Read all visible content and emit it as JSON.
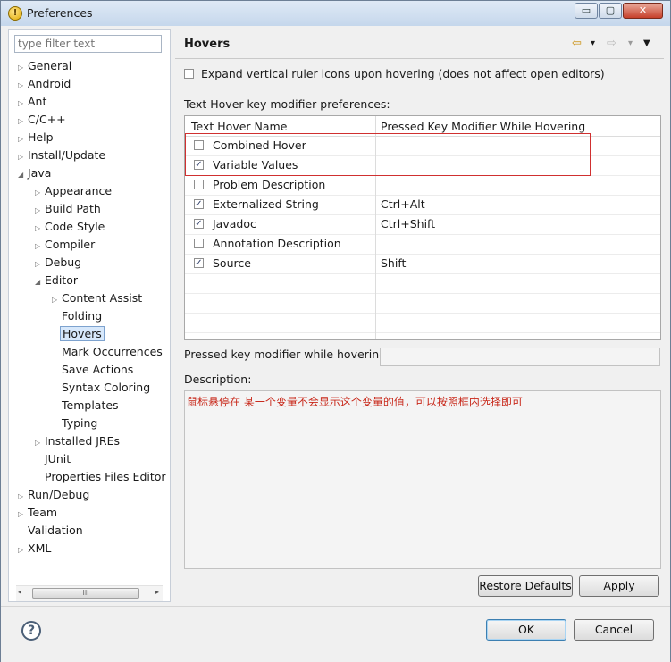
{
  "window": {
    "title": "Preferences",
    "app_icon": "eclipse-icon",
    "controls": {
      "minimize": "▭",
      "maximize": "▢",
      "close": "✕"
    }
  },
  "sidebar": {
    "filter_placeholder": "type filter text",
    "items": [
      {
        "label": "General",
        "toggle": "▷"
      },
      {
        "label": "Android",
        "toggle": "▷"
      },
      {
        "label": "Ant",
        "toggle": "▷"
      },
      {
        "label": "C/C++",
        "toggle": "▷"
      },
      {
        "label": "Help",
        "toggle": "▷"
      },
      {
        "label": "Install/Update",
        "toggle": "▷"
      },
      {
        "label": "Java",
        "toggle": "◢"
      },
      {
        "label": "Appearance",
        "toggle": "▷"
      },
      {
        "label": "Build Path",
        "toggle": "▷"
      },
      {
        "label": "Code Style",
        "toggle": "▷"
      },
      {
        "label": "Compiler",
        "toggle": "▷"
      },
      {
        "label": "Debug",
        "toggle": "▷"
      },
      {
        "label": "Editor",
        "toggle": "◢"
      },
      {
        "label": "Content Assist",
        "toggle": "▷"
      },
      {
        "label": "Folding",
        "toggle": ""
      },
      {
        "label": "Hovers",
        "toggle": ""
      },
      {
        "label": "Mark Occurrences",
        "toggle": ""
      },
      {
        "label": "Save Actions",
        "toggle": ""
      },
      {
        "label": "Syntax Coloring",
        "toggle": ""
      },
      {
        "label": "Templates",
        "toggle": ""
      },
      {
        "label": "Typing",
        "toggle": ""
      },
      {
        "label": "Installed JREs",
        "toggle": "▷"
      },
      {
        "label": "JUnit",
        "toggle": ""
      },
      {
        "label": "Properties Files Editor",
        "toggle": ""
      },
      {
        "label": "Run/Debug",
        "toggle": "▷"
      },
      {
        "label": "Team",
        "toggle": "▷"
      },
      {
        "label": "Validation",
        "toggle": ""
      },
      {
        "label": "XML",
        "toggle": "▷"
      }
    ],
    "scroll_grip": "III",
    "scroll_left": "◂",
    "scroll_right": "▸"
  },
  "page": {
    "title": "Hovers",
    "nav": {
      "back": "⇦",
      "back_menu": "▾",
      "forward": "⇨",
      "forward_menu": "▾",
      "view_menu": "▼"
    },
    "expand_option": {
      "label": "Expand vertical ruler icons upon hovering (does not affect open editors)",
      "checked": false
    },
    "section_label": "Text Hover key modifier preferences:",
    "table": {
      "headers": [
        "Text Hover Name",
        "Pressed Key Modifier While Hovering"
      ],
      "rows": [
        {
          "name": "Combined Hover",
          "checked": false,
          "mark": "",
          "modifier": ""
        },
        {
          "name": "Variable Values",
          "checked": true,
          "mark": "✓",
          "modifier": ""
        },
        {
          "name": "Problem Description",
          "checked": false,
          "mark": "",
          "modifier": ""
        },
        {
          "name": "Externalized String",
          "checked": true,
          "mark": "✓",
          "modifier": "Ctrl+Alt"
        },
        {
          "name": "Javadoc",
          "checked": true,
          "mark": "✓",
          "modifier": "Ctrl+Shift"
        },
        {
          "name": "Annotation Description",
          "checked": false,
          "mark": "",
          "modifier": ""
        },
        {
          "name": "Source",
          "checked": true,
          "mark": "✓",
          "modifier": "Shift"
        }
      ]
    },
    "pressed_label": "Pressed key modifier while hovering:",
    "pressed_value": "",
    "description_label": "Description:",
    "description_text": "鼠标悬停在 某一个变量不会显示这个变量的值，可以按照框内选择即可",
    "restore_defaults": "Restore Defaults",
    "apply": "Apply",
    "highlight_color": "#d03030"
  },
  "footer": {
    "help_icon": "?",
    "ok": "OK",
    "cancel": "Cancel"
  }
}
